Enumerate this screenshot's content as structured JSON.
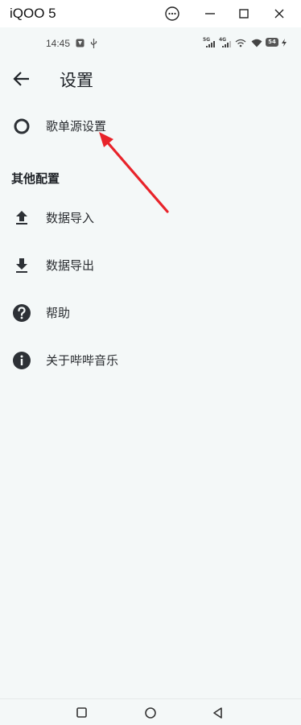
{
  "window": {
    "title": "iQOO 5",
    "controls": [
      "more-icon",
      "minimize-icon",
      "maximize-icon",
      "close-icon"
    ]
  },
  "status_bar": {
    "time": "14:45",
    "network_badges": [
      "5G",
      "4G"
    ],
    "battery": "54"
  },
  "header": {
    "title": "设置"
  },
  "settings": {
    "items": [
      {
        "label": "歌单源设置",
        "icon": "circle-outline-icon"
      }
    ]
  },
  "other": {
    "section_title": "其他配置",
    "items": [
      {
        "label": "数据导入",
        "icon": "upload-icon"
      },
      {
        "label": "数据导出",
        "icon": "download-icon"
      },
      {
        "label": "帮助",
        "icon": "help-icon"
      },
      {
        "label": "关于哔哔音乐",
        "icon": "info-icon"
      }
    ]
  },
  "annotation": {
    "arrow_color": "#e8232a"
  },
  "colors": {
    "background": "#f4f8f8",
    "text": "#1f2328",
    "icon": "#2d3136"
  }
}
